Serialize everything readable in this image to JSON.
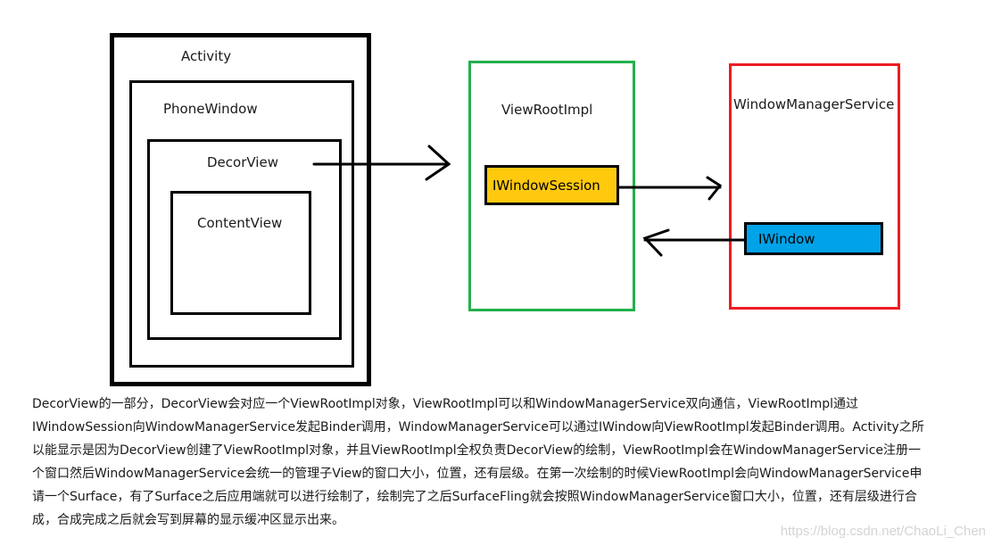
{
  "diagram": {
    "activity": "Activity",
    "phone_window": "PhoneWindow",
    "decor_view": "DecorView",
    "content_view": "ContentView",
    "view_root_impl": "ViewRootImpl",
    "iwindow_session": "IWindowSession",
    "window_manager_service": "WindowManagerService",
    "iwindow": "IWindow",
    "colors": {
      "view_root_impl_border": "#22b04c",
      "window_manager_service_border": "#ed1c24",
      "iwindow_session_fill": "#ffc90e",
      "iwindow_fill": "#00a2e8"
    },
    "arrows": [
      {
        "from": "DecorView",
        "to": "ViewRootImpl"
      },
      {
        "from": "IWindowSession",
        "to": "WindowManagerService"
      },
      {
        "from": "IWindow",
        "to": "ViewRootImpl"
      }
    ]
  },
  "description": {
    "lines": [
      "DecorView的一部分，DecorView会对应一个ViewRootImpl对象，ViewRootImpl可以和WindowManagerService双向通信，ViewRootImpl通过",
      "IWindowSession向WindowManagerService发起Binder调用，WindowManagerService可以通过IWindow向ViewRootImpl发起Binder调用。Activity之所",
      "以能显示是因为DecorView创建了ViewRootImpl对象，并且ViewRootImpl全权负责DecorView的绘制，ViewRootImpl会在WindowManagerService注册一",
      "个窗口然后WindowManagerService会统一的管理子View的窗口大小，位置，还有层级。在第一次绘制的时候ViewRootImpl会向WindowManagerService申",
      "请一个Surface，有了Surface之后应用端就可以进行绘制了，绘制完了之后SurfaceFling就会按照WindowManagerService窗口大小，位置，还有层级进行合",
      "成，合成完成之后就会写到屏幕的显示缓冲区显示出来。"
    ]
  },
  "watermark": "https://blog.csdn.net/ChaoLi_Chen"
}
